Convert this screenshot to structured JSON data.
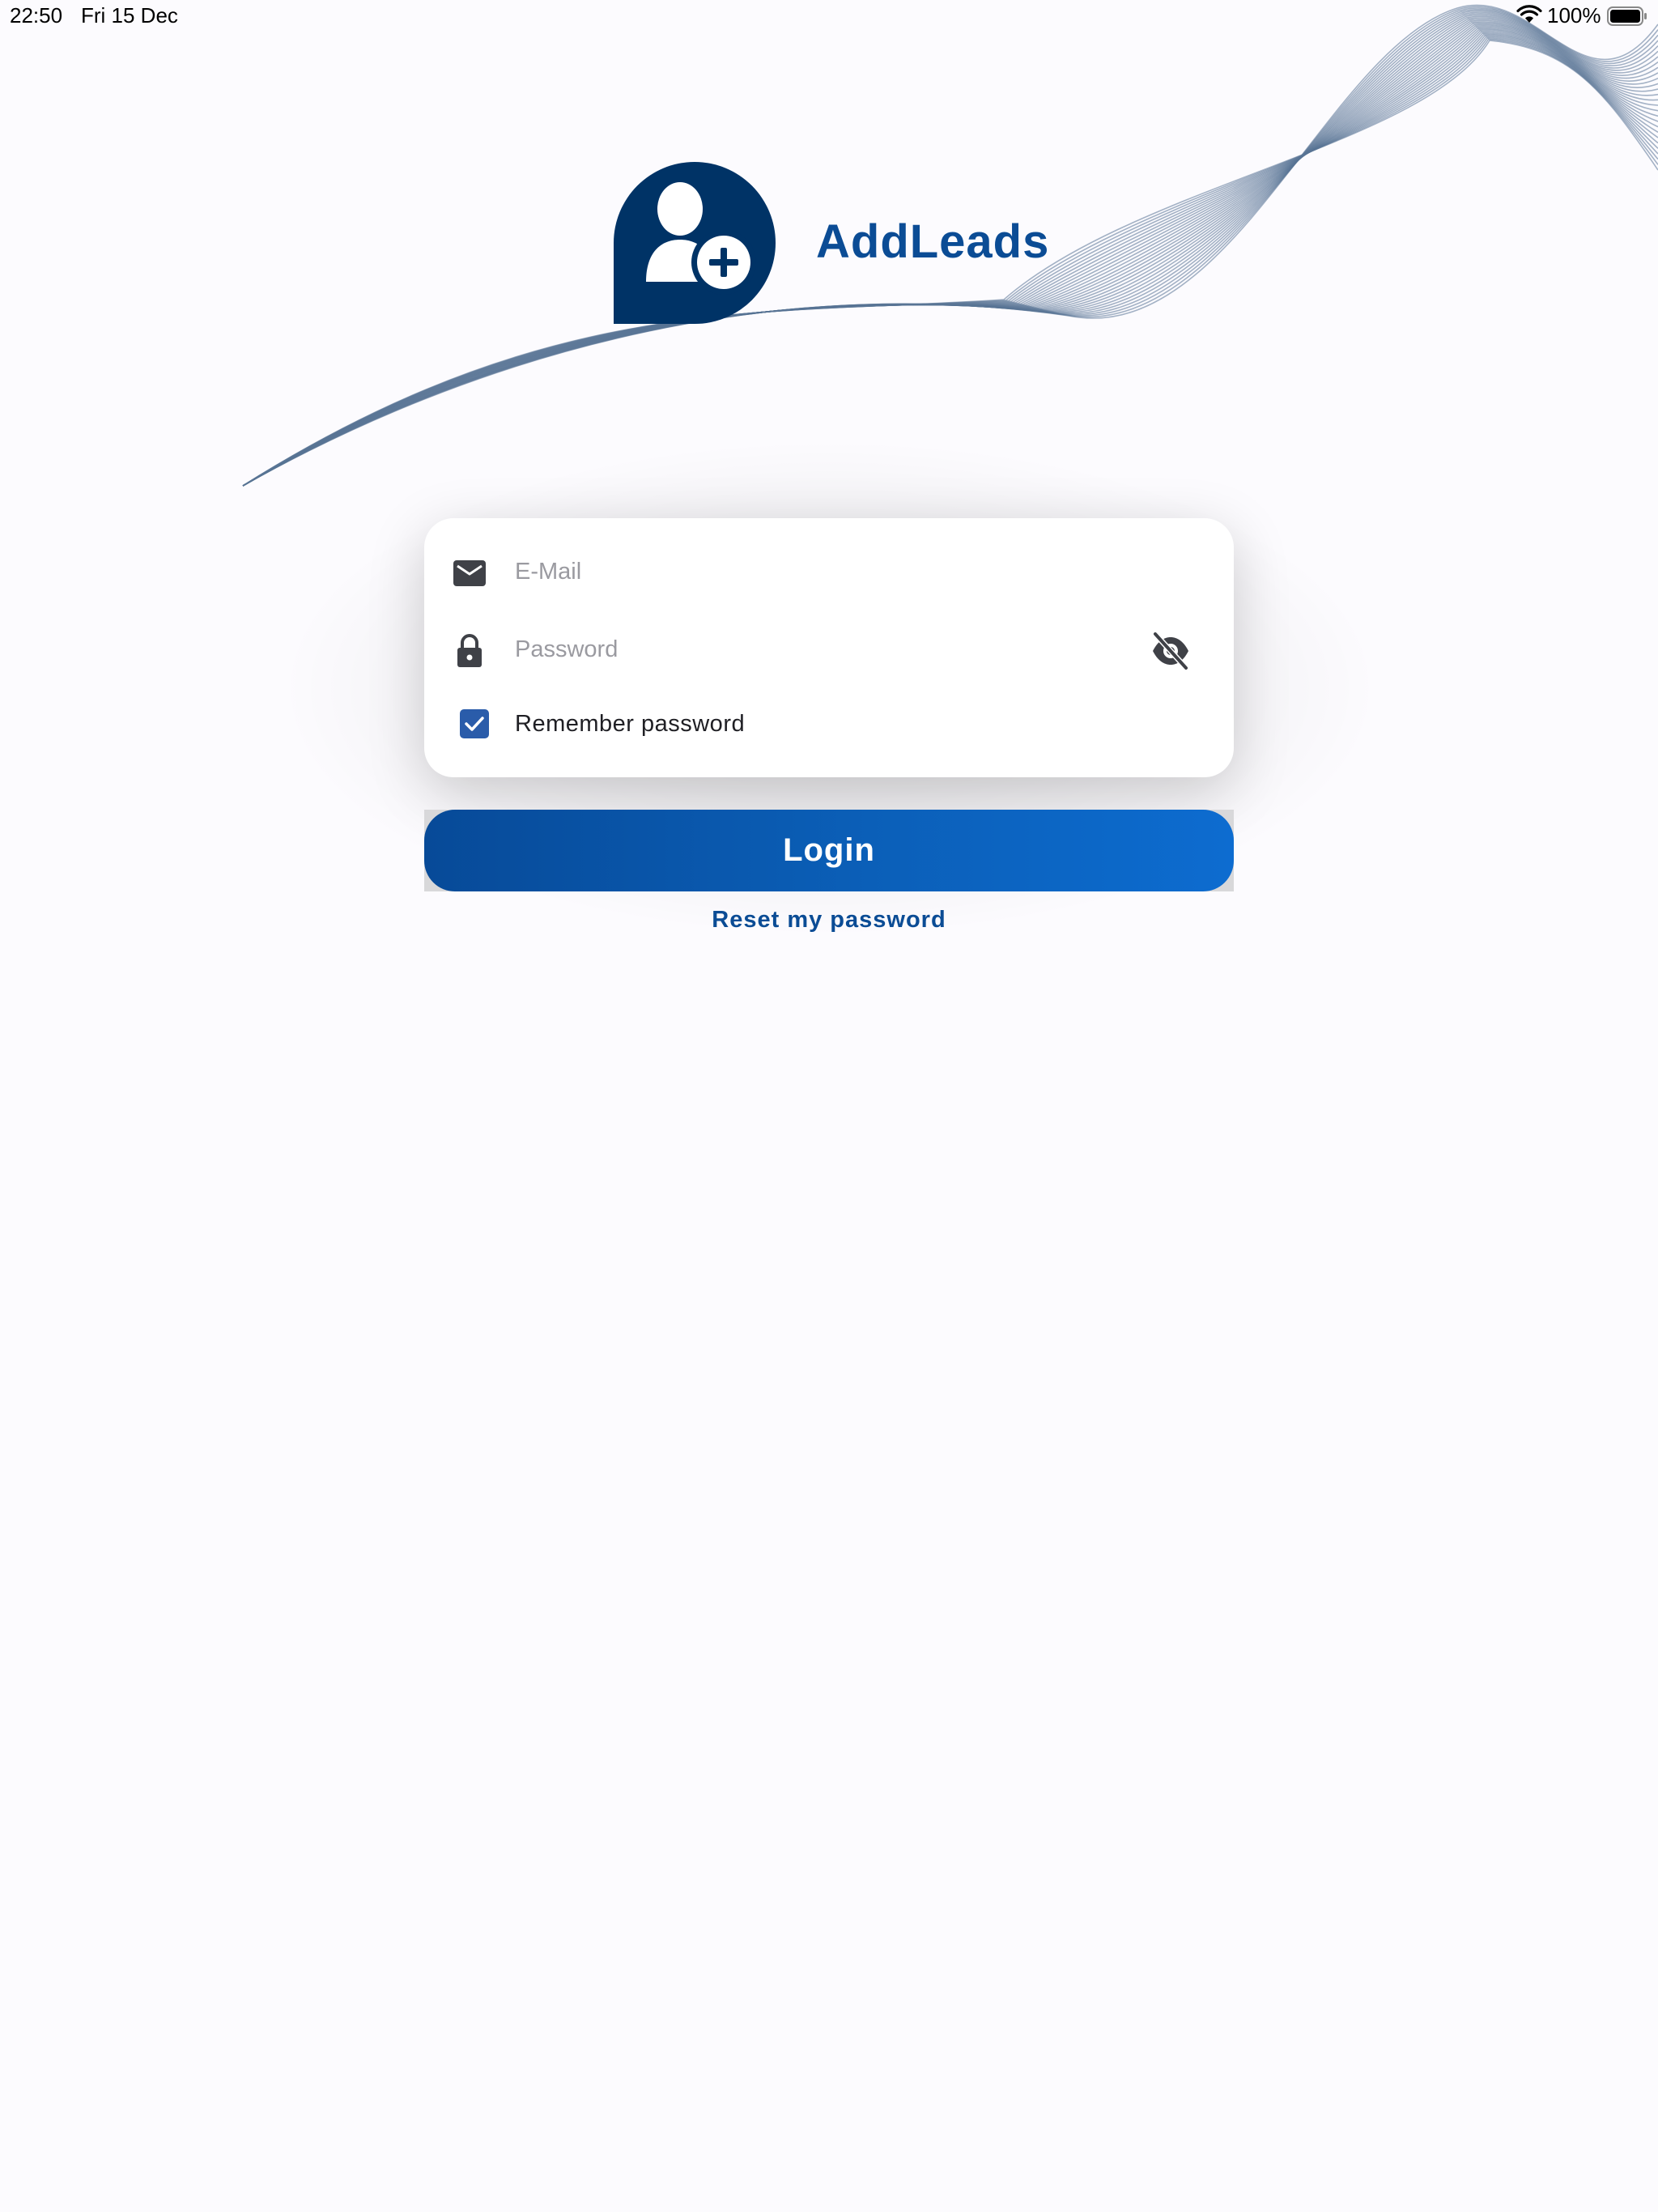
{
  "status_bar": {
    "time": "22:50",
    "date": "Fri 15 Dec",
    "battery": "100%",
    "wifi_icon": "wifi-icon",
    "battery_icon": "battery-icon"
  },
  "brand": {
    "name": "AddLeads",
    "logo_icon": "add-user-icon",
    "color": "#0b4c95",
    "logo_color": "#003366"
  },
  "form": {
    "email": {
      "placeholder": "E-Mail",
      "value": "",
      "icon": "envelope-icon"
    },
    "password": {
      "placeholder": "Password",
      "value": "",
      "icon": "lock-icon",
      "visibility_icon": "eye-slash-icon"
    },
    "remember": {
      "label": "Remember password",
      "checked": true,
      "color": "#2a5caa"
    }
  },
  "actions": {
    "login_label": "Login",
    "reset_label": "Reset my password",
    "button_color_start": "#074a98",
    "button_color_end": "#0d6cd0"
  }
}
